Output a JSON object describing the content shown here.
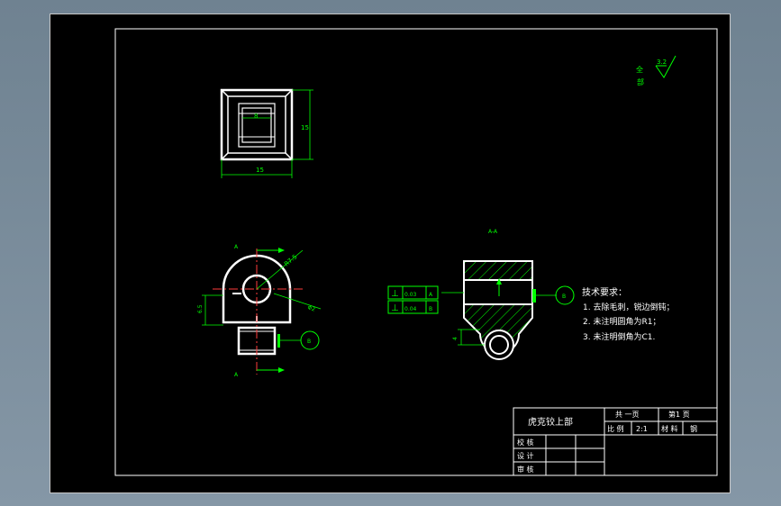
{
  "title_block": {
    "part_name": "虎克铰上部",
    "sheet_total": "共 一页",
    "sheet_number": "第1 页",
    "scale_label": "比 例",
    "scale_value": "2:1",
    "material_label": "材 料",
    "material_value": "钢",
    "roles": [
      "校 核",
      "设 计",
      "审 核"
    ]
  },
  "technical_requirements": {
    "heading": "技术要求：",
    "items": [
      "1. 去除毛刺，锐边倒钝；",
      "2. 未注明圆角为R1；",
      "3. 未注明倒角为C1."
    ]
  },
  "surface_finish": {
    "label_line1": "全",
    "label_line2": "部",
    "value": "3.2"
  },
  "top_view": {
    "inner_dim": "8",
    "height_dim": "15",
    "width_dim": "15"
  },
  "front_view": {
    "radius_dim": "R7.5",
    "height_dim": "6.5",
    "hole_dim": "Φ2",
    "section_mark_top": "A",
    "section_mark_bottom": "A",
    "datum": "B"
  },
  "section_view": {
    "label": "A-A",
    "tolerances": [
      {
        "symbol": "⊥",
        "value": "0.03",
        "datum": "A"
      },
      {
        "symbol": "⊥",
        "value": "0.04",
        "datum": "B"
      }
    ],
    "side_dim": "4",
    "datum": "B"
  },
  "colors": {
    "line": "#ffffff",
    "dim": "#00ff00",
    "text": "#ffffff"
  }
}
